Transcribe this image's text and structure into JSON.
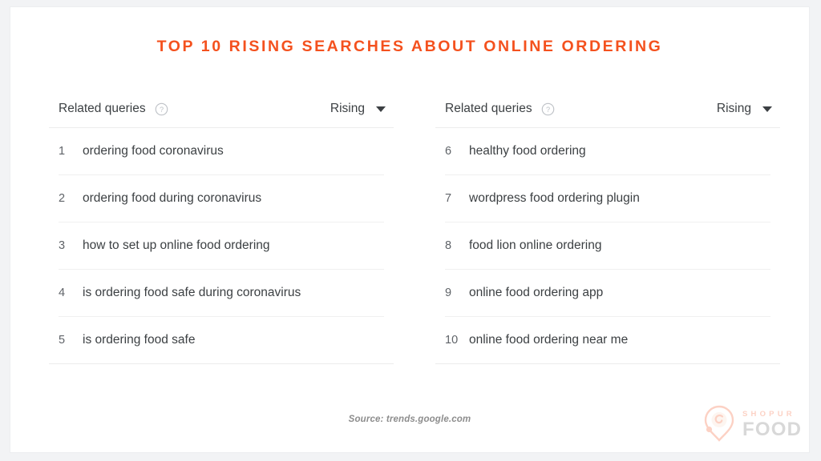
{
  "title": "Top 10 Rising Searches About Online Ordering",
  "accent_color": "#F4511E",
  "panels": [
    {
      "header_label": "Related queries",
      "help_icon": "help-circle-icon",
      "sort_label": "Rising",
      "caret_icon": "chevron-down-icon",
      "rows": [
        {
          "rank": "1",
          "query": "ordering food coronavirus"
        },
        {
          "rank": "2",
          "query": "ordering food during coronavirus"
        },
        {
          "rank": "3",
          "query": "how to set up online food ordering"
        },
        {
          "rank": "4",
          "query": "is ordering food safe during coronavirus"
        },
        {
          "rank": "5",
          "query": "is ordering food safe"
        }
      ]
    },
    {
      "header_label": "Related queries",
      "help_icon": "help-circle-icon",
      "sort_label": "Rising",
      "caret_icon": "chevron-down-icon",
      "rows": [
        {
          "rank": "6",
          "query": "healthy food ordering"
        },
        {
          "rank": "7",
          "query": "wordpress food ordering plugin"
        },
        {
          "rank": "8",
          "query": "food lion online ordering"
        },
        {
          "rank": "9",
          "query": "online food ordering app"
        },
        {
          "rank": "10",
          "query": "online food ordering near me"
        }
      ]
    }
  ],
  "source": "Source: trends.google.com",
  "logo": {
    "mark_icon": "location-pin-icon",
    "top_text": "SHOPUR",
    "bottom_text": "FOOD"
  }
}
